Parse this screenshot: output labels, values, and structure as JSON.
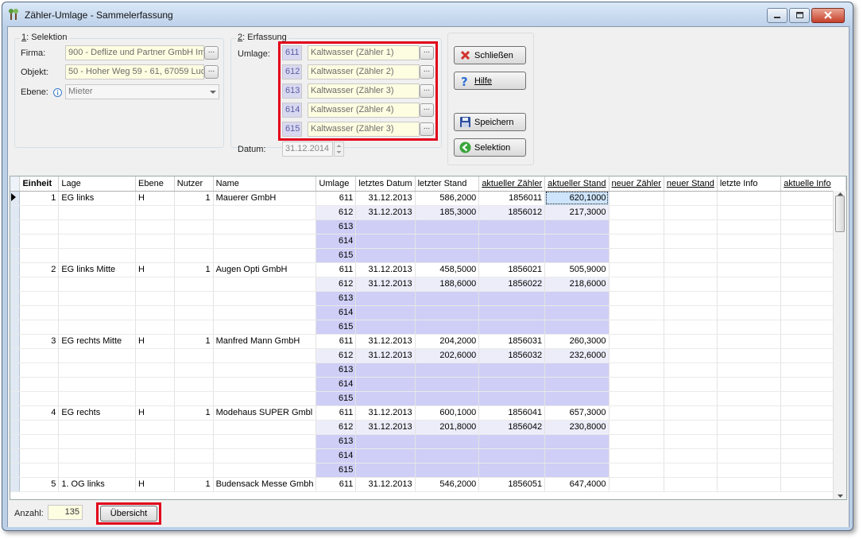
{
  "window": {
    "title": "Zähler-Umlage - Sammelerfassung"
  },
  "selektion": {
    "group_title_prefix": "1",
    "group_title": ": Selektion",
    "firma_label": "Firma:",
    "firma_value": "900 - Deflize und Partner GmbH Imr",
    "objekt_label": "Objekt:",
    "objekt_value": "50 - Hoher Weg 59 - 61, 67059 Luc",
    "ebene_label": "Ebene:",
    "ebene_value": "Mieter",
    "dots": "..."
  },
  "erfassung": {
    "group_title_prefix": "2",
    "group_title": ": Erfassung",
    "umlage_label": "Umlage:",
    "rows": [
      {
        "num": "611",
        "name": "Kaltwasser (Zähler 1)"
      },
      {
        "num": "612",
        "name": "Kaltwasser (Zähler 2)"
      },
      {
        "num": "613",
        "name": "Kaltwasser (Zähler 3)"
      },
      {
        "num": "614",
        "name": "Kaltwasser (Zähler 4)"
      },
      {
        "num": "615",
        "name": "Kaltwasser (Zähler 3)"
      }
    ],
    "datum_label": "Datum:",
    "datum_value": "31.12.2014"
  },
  "buttons": {
    "schliessen": "Schließen",
    "hilfe": "Hilfe",
    "speichern": "Speichern",
    "selektion": "Selektion",
    "uebersicht": "Übersicht"
  },
  "table": {
    "columns": [
      "Einheit",
      "Lage",
      "Ebene",
      "Nutzer",
      "Name",
      "Umlage",
      "letztes Datum",
      "letzter Stand",
      "aktueller Zähler",
      "aktueller Stand",
      "neuer Zähler",
      "neuer Stand",
      "letzte Info",
      "aktuelle Info"
    ],
    "rows": [
      [
        "1",
        "EG links",
        "H",
        "1",
        "Mauerer GmbH",
        "611",
        "31.12.2013",
        "586,2000",
        "1856011",
        "620,1000",
        "",
        "",
        "",
        ""
      ],
      [
        "",
        "",
        "",
        "",
        "",
        "612",
        "31.12.2013",
        "185,3000",
        "1856012",
        "217,3000",
        "",
        "",
        "",
        ""
      ],
      [
        "",
        "",
        "",
        "",
        "",
        "613",
        "",
        "",
        "",
        "",
        "",
        "",
        "",
        ""
      ],
      [
        "",
        "",
        "",
        "",
        "",
        "614",
        "",
        "",
        "",
        "",
        "",
        "",
        "",
        ""
      ],
      [
        "",
        "",
        "",
        "",
        "",
        "615",
        "",
        "",
        "",
        "",
        "",
        "",
        "",
        ""
      ],
      [
        "2",
        "EG links Mitte",
        "H",
        "1",
        "Augen Opti GmbH",
        "611",
        "31.12.2013",
        "458,5000",
        "1856021",
        "505,9000",
        "",
        "",
        "",
        ""
      ],
      [
        "",
        "",
        "",
        "",
        "",
        "612",
        "31.12.2013",
        "188,6000",
        "1856022",
        "218,6000",
        "",
        "",
        "",
        ""
      ],
      [
        "",
        "",
        "",
        "",
        "",
        "613",
        "",
        "",
        "",
        "",
        "",
        "",
        "",
        ""
      ],
      [
        "",
        "",
        "",
        "",
        "",
        "614",
        "",
        "",
        "",
        "",
        "",
        "",
        "",
        ""
      ],
      [
        "",
        "",
        "",
        "",
        "",
        "615",
        "",
        "",
        "",
        "",
        "",
        "",
        "",
        ""
      ],
      [
        "3",
        "EG rechts Mitte",
        "H",
        "1",
        "Manfred Mann GmbH",
        "611",
        "31.12.2013",
        "204,2000",
        "1856031",
        "260,3000",
        "",
        "",
        "",
        ""
      ],
      [
        "",
        "",
        "",
        "",
        "",
        "612",
        "31.12.2013",
        "202,6000",
        "1856032",
        "232,6000",
        "",
        "",
        "",
        ""
      ],
      [
        "",
        "",
        "",
        "",
        "",
        "613",
        "",
        "",
        "",
        "",
        "",
        "",
        "",
        ""
      ],
      [
        "",
        "",
        "",
        "",
        "",
        "614",
        "",
        "",
        "",
        "",
        "",
        "",
        "",
        ""
      ],
      [
        "",
        "",
        "",
        "",
        "",
        "615",
        "",
        "",
        "",
        "",
        "",
        "",
        "",
        ""
      ],
      [
        "4",
        "EG rechts",
        "H",
        "1",
        "Modehaus SUPER Gmbl",
        "611",
        "31.12.2013",
        "600,1000",
        "1856041",
        "657,3000",
        "",
        "",
        "",
        ""
      ],
      [
        "",
        "",
        "",
        "",
        "",
        "612",
        "31.12.2013",
        "201,8000",
        "1856042",
        "230,8000",
        "",
        "",
        "",
        ""
      ],
      [
        "",
        "",
        "",
        "",
        "",
        "613",
        "",
        "",
        "",
        "",
        "",
        "",
        "",
        ""
      ],
      [
        "",
        "",
        "",
        "",
        "",
        "614",
        "",
        "",
        "",
        "",
        "",
        "",
        "",
        ""
      ],
      [
        "",
        "",
        "",
        "",
        "",
        "615",
        "",
        "",
        "",
        "",
        "",
        "",
        "",
        ""
      ],
      [
        "5",
        "1. OG links",
        "H",
        "1",
        "Budensack Messe Gmbh",
        "611",
        "31.12.2013",
        "546,2000",
        "1856051",
        "647,4000",
        "",
        "",
        "",
        ""
      ]
    ]
  },
  "footer": {
    "anzahl_label": "Anzahl:",
    "anzahl_value": "135"
  }
}
